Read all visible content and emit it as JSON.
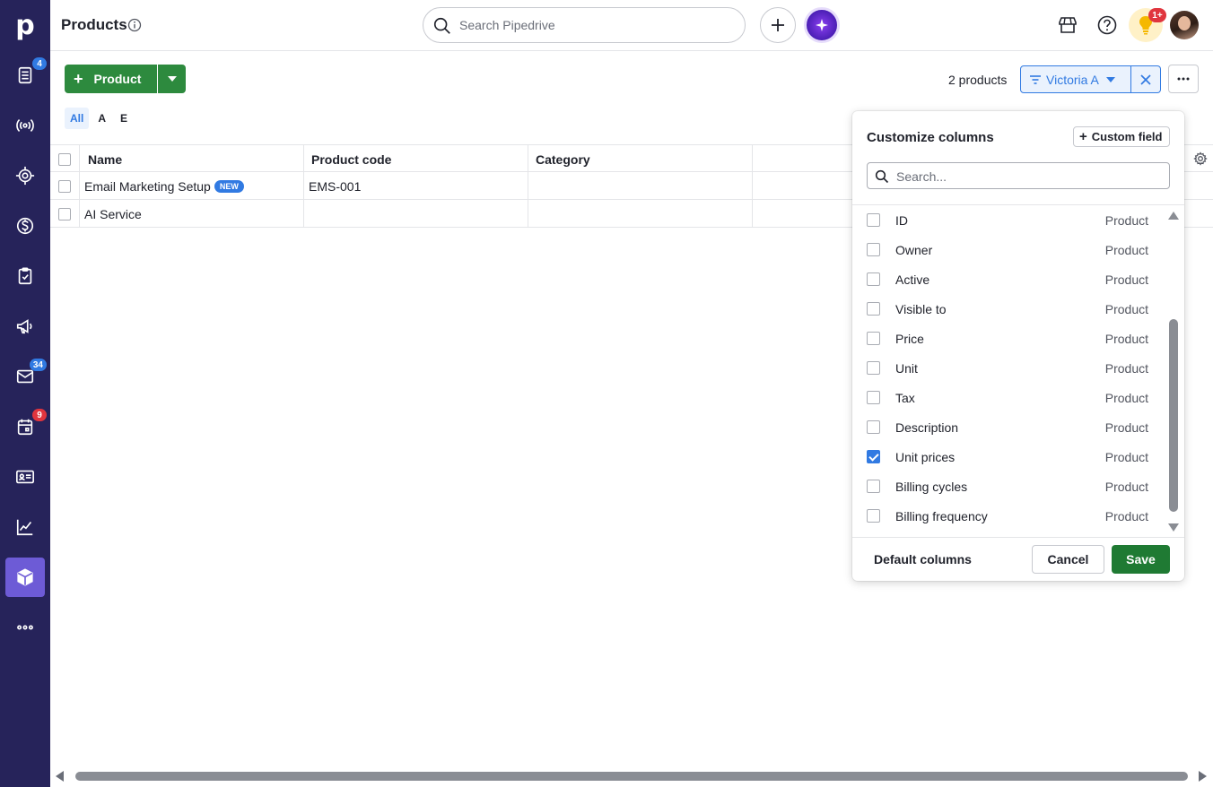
{
  "app": {
    "logo_letter": "p",
    "page_title": "Products"
  },
  "sidebar": {
    "items": [
      {
        "name": "leads",
        "icon": "leads-icon",
        "badge": "4",
        "badge_color": "#317ae2"
      },
      {
        "name": "campaigns-radio",
        "icon": "broadcast-icon",
        "badge": "",
        "badge_color": ""
      },
      {
        "name": "deals",
        "icon": "target-icon",
        "badge": "",
        "badge_color": ""
      },
      {
        "name": "money",
        "icon": "dollar-icon",
        "badge": "",
        "badge_color": ""
      },
      {
        "name": "activities",
        "icon": "clipboard-check-icon",
        "badge": "",
        "badge_color": ""
      },
      {
        "name": "campaigns",
        "icon": "megaphone-icon",
        "badge": "",
        "badge_color": ""
      },
      {
        "name": "mail",
        "icon": "mail-icon",
        "badge": "34",
        "badge_color": "#317ae2"
      },
      {
        "name": "calendar",
        "icon": "calendar-icon",
        "badge": "9",
        "badge_color": "#e0353e"
      },
      {
        "name": "contacts",
        "icon": "contact-card-icon",
        "badge": "",
        "badge_color": ""
      },
      {
        "name": "insights",
        "icon": "chart-line-icon",
        "badge": "",
        "badge_color": ""
      },
      {
        "name": "products",
        "icon": "box-icon",
        "badge": "",
        "badge_color": "",
        "active": true
      },
      {
        "name": "more",
        "icon": "more-dots-icon",
        "badge": "",
        "badge_color": ""
      }
    ]
  },
  "topbar": {
    "search_placeholder": "Search Pipedrive",
    "notifications_badge": "1+"
  },
  "toolbar": {
    "add_label": "Product",
    "count_label": "2 products",
    "filter_label": "Victoria A"
  },
  "letters": [
    "All",
    "A",
    "E"
  ],
  "table": {
    "columns": [
      "Name",
      "Product code",
      "Category"
    ],
    "rows": [
      {
        "name": "Email Marketing Setup",
        "badge": "NEW",
        "code": "EMS-001",
        "category": ""
      },
      {
        "name": "AI Service",
        "badge": "",
        "code": "",
        "category": ""
      }
    ]
  },
  "customize": {
    "title": "Customize columns",
    "custom_field_label": "Custom field",
    "search_placeholder": "Search...",
    "fields": [
      {
        "label": "ID",
        "type": "Product",
        "checked": false
      },
      {
        "label": "Owner",
        "type": "Product",
        "checked": false
      },
      {
        "label": "Active",
        "type": "Product",
        "checked": false
      },
      {
        "label": "Visible to",
        "type": "Product",
        "checked": false
      },
      {
        "label": "Price",
        "type": "Product",
        "checked": false
      },
      {
        "label": "Unit",
        "type": "Product",
        "checked": false
      },
      {
        "label": "Tax",
        "type": "Product",
        "checked": false
      },
      {
        "label": "Description",
        "type": "Product",
        "checked": false
      },
      {
        "label": "Unit prices",
        "type": "Product",
        "checked": true
      },
      {
        "label": "Billing cycles",
        "type": "Product",
        "checked": false
      },
      {
        "label": "Billing frequency",
        "type": "Product",
        "checked": false
      }
    ],
    "default_label": "Default columns",
    "cancel_label": "Cancel",
    "save_label": "Save"
  },
  "colors": {
    "sidebar_bg": "#26235a",
    "primary_green": "#2d8a3e",
    "save_green": "#1f7a33",
    "accent_blue": "#317ae2"
  }
}
